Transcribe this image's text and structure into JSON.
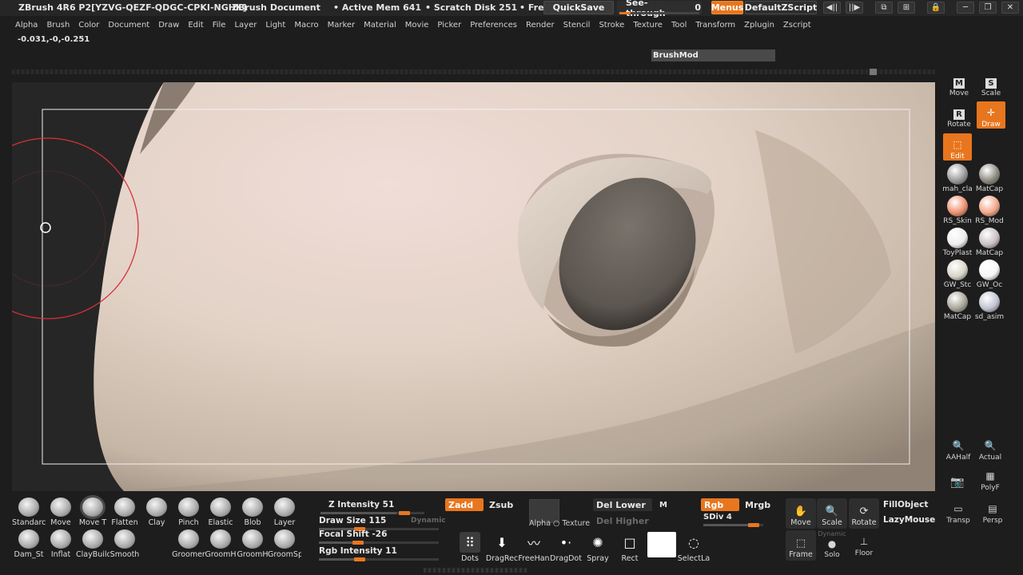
{
  "titlebar": {
    "app_title": "ZBrush 4R6 P2[YZVG-QEZF-QDGC-CPKI-NGHK]",
    "document": "ZBrush Document",
    "active_mem": "• Active Mem 641",
    "scratch_disk": "• Scratch Disk 251",
    "free": "• Fre",
    "quicksave": "QuickSave",
    "see_through": "See-through",
    "see_through_value": "0",
    "menus": "Menus",
    "default_zscript": "DefaultZScript"
  },
  "menubar": [
    "Alpha",
    "Brush",
    "Color",
    "Document",
    "Draw",
    "Edit",
    "File",
    "Layer",
    "Light",
    "Macro",
    "Marker",
    "Material",
    "Movie",
    "Picker",
    "Preferences",
    "Render",
    "Stencil",
    "Stroke",
    "Texture",
    "Tool",
    "Transform",
    "Zplugin",
    "Zscript"
  ],
  "coords": "-0.031,-0,-0.251",
  "brushmod": "BrushMod",
  "right_shelf": {
    "move": "Move",
    "scale": "Scale",
    "rotate": "Rotate",
    "draw": "Draw",
    "edit": "Edit",
    "materials": [
      {
        "label": "mah_cla",
        "color": "#9a9a9a"
      },
      {
        "label": "MatCap",
        "color": "#8d8a80"
      },
      {
        "label": "RS_Skin",
        "color": "#f09070"
      },
      {
        "label": "RS_Mod",
        "color": "#f2a688"
      },
      {
        "label": "ToyPlast",
        "color": "#f0ecec"
      },
      {
        "label": "MatCap",
        "color": "#c9c0c0"
      },
      {
        "label": "GW_Stc",
        "color": "#d8d4c8"
      },
      {
        "label": "GW_Oc",
        "color": "#f5f5f5"
      },
      {
        "label": "MatCap",
        "color": "#a8a498"
      },
      {
        "label": "sd_asim",
        "color": "#c0c4d0"
      }
    ],
    "aahalf": "AAHalf",
    "actual": "Actual",
    "polyf": "PolyF"
  },
  "brushes_row1": [
    "Standarc",
    "Move",
    "Move T",
    "Flatten",
    "Clay",
    "Pinch",
    "Elastic",
    "Blob",
    "Layer"
  ],
  "brushes_row2": [
    "Dam_St",
    "Inflat",
    "ClayBuilc",
    "Smooth",
    "",
    "Groomer",
    "GroomH",
    "GroomH",
    "GroomSp"
  ],
  "sliders": {
    "z_intensity": "Z Intensity 51",
    "z_intensity_value": 51,
    "draw_size": "Draw Size 115",
    "dynamic": "Dynamic",
    "focal_shift": "Focal Shift -26",
    "rgb_intensity": "Rgb Intensity 11"
  },
  "buttons": {
    "zadd": "Zadd",
    "zsub": "Zsub",
    "alpha": "Alpha",
    "texture": "Texture",
    "del_lower": "Del Lower",
    "del_higher": "Del Higher",
    "m": "M",
    "rgb": "Rgb",
    "mrgb": "Mrgb",
    "sdiv": "SDiv 4",
    "fillobject": "FillObject",
    "lazymouse": "LazyMouse"
  },
  "strokes": [
    "Dots",
    "DragRec",
    "FreeHan",
    "DragDot",
    "Spray",
    "Rect",
    "",
    "SelectLa"
  ],
  "transform_buttons": {
    "move": "Move",
    "scale": "Scale",
    "rotate": "Rotate",
    "transp": "Transp",
    "persp": "Persp",
    "frame": "Frame",
    "solo": "Solo",
    "dynamic": "Dynamic",
    "floor": "Floor"
  }
}
